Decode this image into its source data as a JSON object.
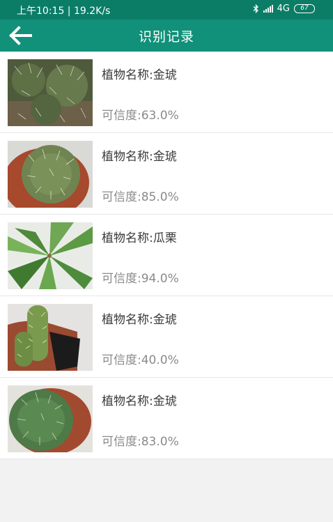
{
  "status_bar": {
    "time": "上午10:15 | 19.2K/s",
    "network": "4G",
    "battery": "67"
  },
  "header": {
    "title": "识别记录"
  },
  "records": [
    {
      "name": "植物名称:金琥",
      "confidence": "可信度:63.0%",
      "image": "cactus-closeup"
    },
    {
      "name": "植物名称:金琥",
      "confidence": "可信度:85.0%",
      "image": "cactus-in-pot"
    },
    {
      "name": "植物名称:瓜栗",
      "confidence": "可信度:94.0%",
      "image": "pachira-leaves"
    },
    {
      "name": "植物名称:金琥",
      "confidence": "可信度:40.0%",
      "image": "columnar-cactus"
    },
    {
      "name": "植物名称:金琥",
      "confidence": "可信度:83.0%",
      "image": "barrel-cactus-pot"
    }
  ]
}
